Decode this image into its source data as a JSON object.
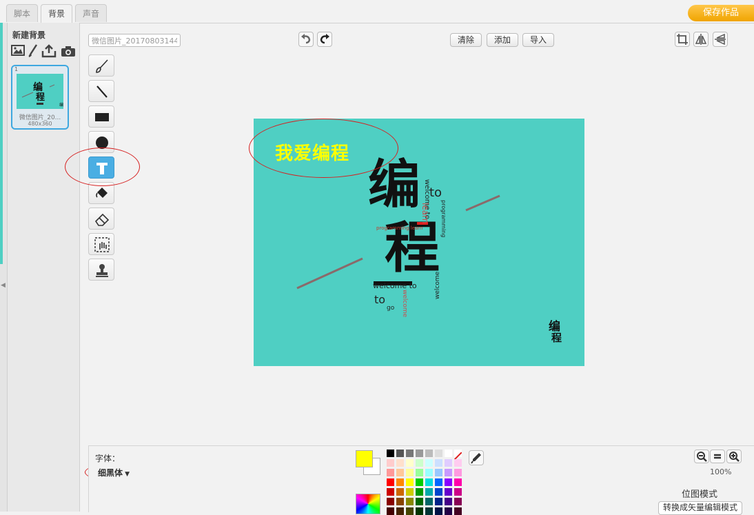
{
  "tabs": [
    {
      "label": "脚本"
    },
    {
      "label": "背景"
    },
    {
      "label": "声音"
    }
  ],
  "active_tab": "背景",
  "save_button": "保存作品",
  "sidebar": {
    "new_backdrop_label": "新建背景",
    "new_backdrop_icons": [
      "image-library-icon",
      "paint-brush-icon",
      "upload-icon",
      "camera-icon"
    ],
    "backdrop": {
      "number": "1",
      "name": "微信图片_20...",
      "size": "480x360"
    }
  },
  "editor": {
    "costume_name": "微信图片_20170803144",
    "undo_icon": "undo-icon",
    "redo_icon": "redo-icon",
    "clear_label": "清除",
    "add_label": "添加",
    "import_label": "导入",
    "tools": [
      "brush",
      "line",
      "rectangle",
      "ellipse",
      "text",
      "fill",
      "eraser",
      "select",
      "stamp"
    ],
    "active_tool": "text"
  },
  "canvas": {
    "caption_text": "我爱编程",
    "caption_color": "#ffff00",
    "background_color": "#4fcfc3",
    "big_chars": [
      "编",
      "程"
    ],
    "small_words": [
      "welcome to",
      "to",
      "programming",
      "learn",
      "programming learn",
      "welcome",
      "go"
    ]
  },
  "bottom": {
    "font_label": "字体：",
    "font_value": "细黑体",
    "primary_color": "#ffff00",
    "secondary_color": "#ffffff",
    "zoom": "100%",
    "mode_label": "位图模式",
    "convert_button": "转换成矢量编辑模式"
  },
  "palette": [
    [
      "#000000",
      "#555555",
      "#777777",
      "#999999",
      "#bbbbbb",
      "#dddddd",
      "#ffffff",
      "none"
    ],
    [
      "#ffcccc",
      "#ffe0cc",
      "#ffffcc",
      "#ccffcc",
      "#ccffff",
      "#cce0ff",
      "#e0ccff",
      "#ffccf0"
    ],
    [
      "#ff9999",
      "#ffc899",
      "#ffff99",
      "#99ff99",
      "#99ffff",
      "#99c8ff",
      "#c899ff",
      "#ff99e0"
    ],
    [
      "#ff0000",
      "#ff8800",
      "#ffff00",
      "#00cc00",
      "#00dddd",
      "#0066ff",
      "#8800ff",
      "#ff00aa"
    ],
    [
      "#cc0000",
      "#cc6600",
      "#cccc00",
      "#009900",
      "#00aaaa",
      "#0044cc",
      "#6600cc",
      "#cc0088"
    ],
    [
      "#880000",
      "#884400",
      "#888800",
      "#006600",
      "#006666",
      "#002288",
      "#440088",
      "#880055"
    ],
    [
      "#440000",
      "#442200",
      "#444400",
      "#003300",
      "#003333",
      "#001144",
      "#220044",
      "#440022"
    ]
  ]
}
